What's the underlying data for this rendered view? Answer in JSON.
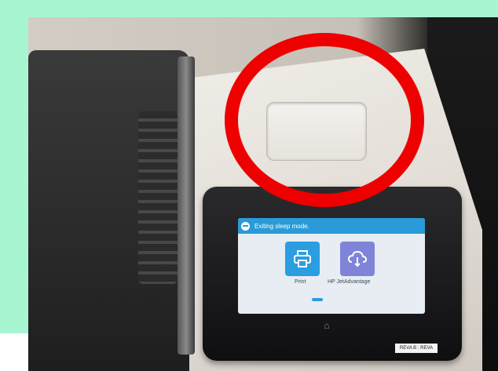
{
  "photo": {
    "panel_status_text": "Exiting sleep mode.",
    "apps": [
      {
        "label": "Print",
        "icon": "printer-icon"
      },
      {
        "label": "HP JetAdvantage",
        "icon": "cloud-icon"
      }
    ],
    "panel_sticker": "REVA B : REVA",
    "colors": {
      "background": "#a8f5d2",
      "ring": "#ee0000",
      "status_bar": "#2a9bd8",
      "print_tile": "#2b9de0",
      "hp_tile": "#7f84d8"
    }
  }
}
